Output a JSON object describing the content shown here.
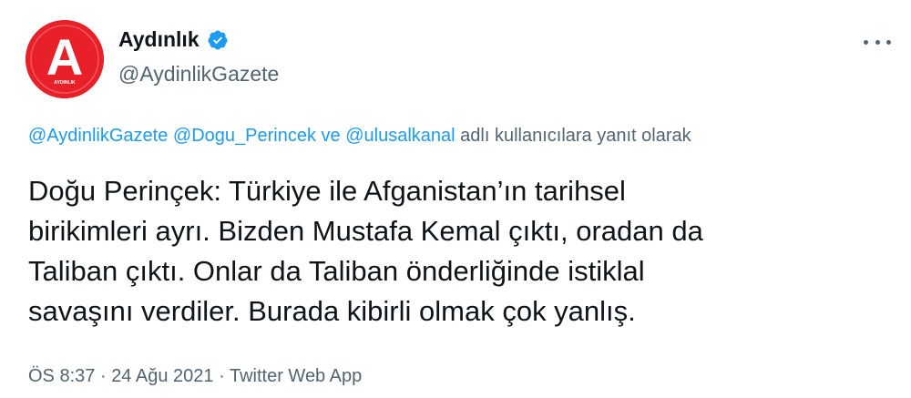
{
  "account": {
    "display_name": "Aydınlık",
    "handle": "@AydinlikGazete",
    "avatar_letter": "A",
    "avatar_subtext": "AYDINLIK",
    "brand_color": "#e8202a",
    "verified_color": "#1d9bf0"
  },
  "reply": {
    "mention1": "@AydinlikGazete",
    "mention2": "@Dogu_Perincek",
    "conjunction": "ve",
    "mention3": "@ulusalkanal",
    "suffix": "adlı kullanıcılara yanıt olarak"
  },
  "tweet": {
    "lines": [
      "Doğu Perinçek: Türkiye ile Afganistan’ın tarihsel",
      "birikimleri ayrı. Bizden Mustafa Kemal çıktı, oradan da",
      "Taliban çıktı. Onlar da Taliban önderliğinde istiklal",
      "savaşını verdiler. Burada kibirli olmak çok yanlış."
    ]
  },
  "meta": {
    "time": "ÖS 8:37",
    "separator": "·",
    "date": "24 Ağu 2021",
    "source": "Twitter Web App"
  },
  "icons": {
    "verified": "verified-badge-icon",
    "more": "more-options-icon"
  }
}
